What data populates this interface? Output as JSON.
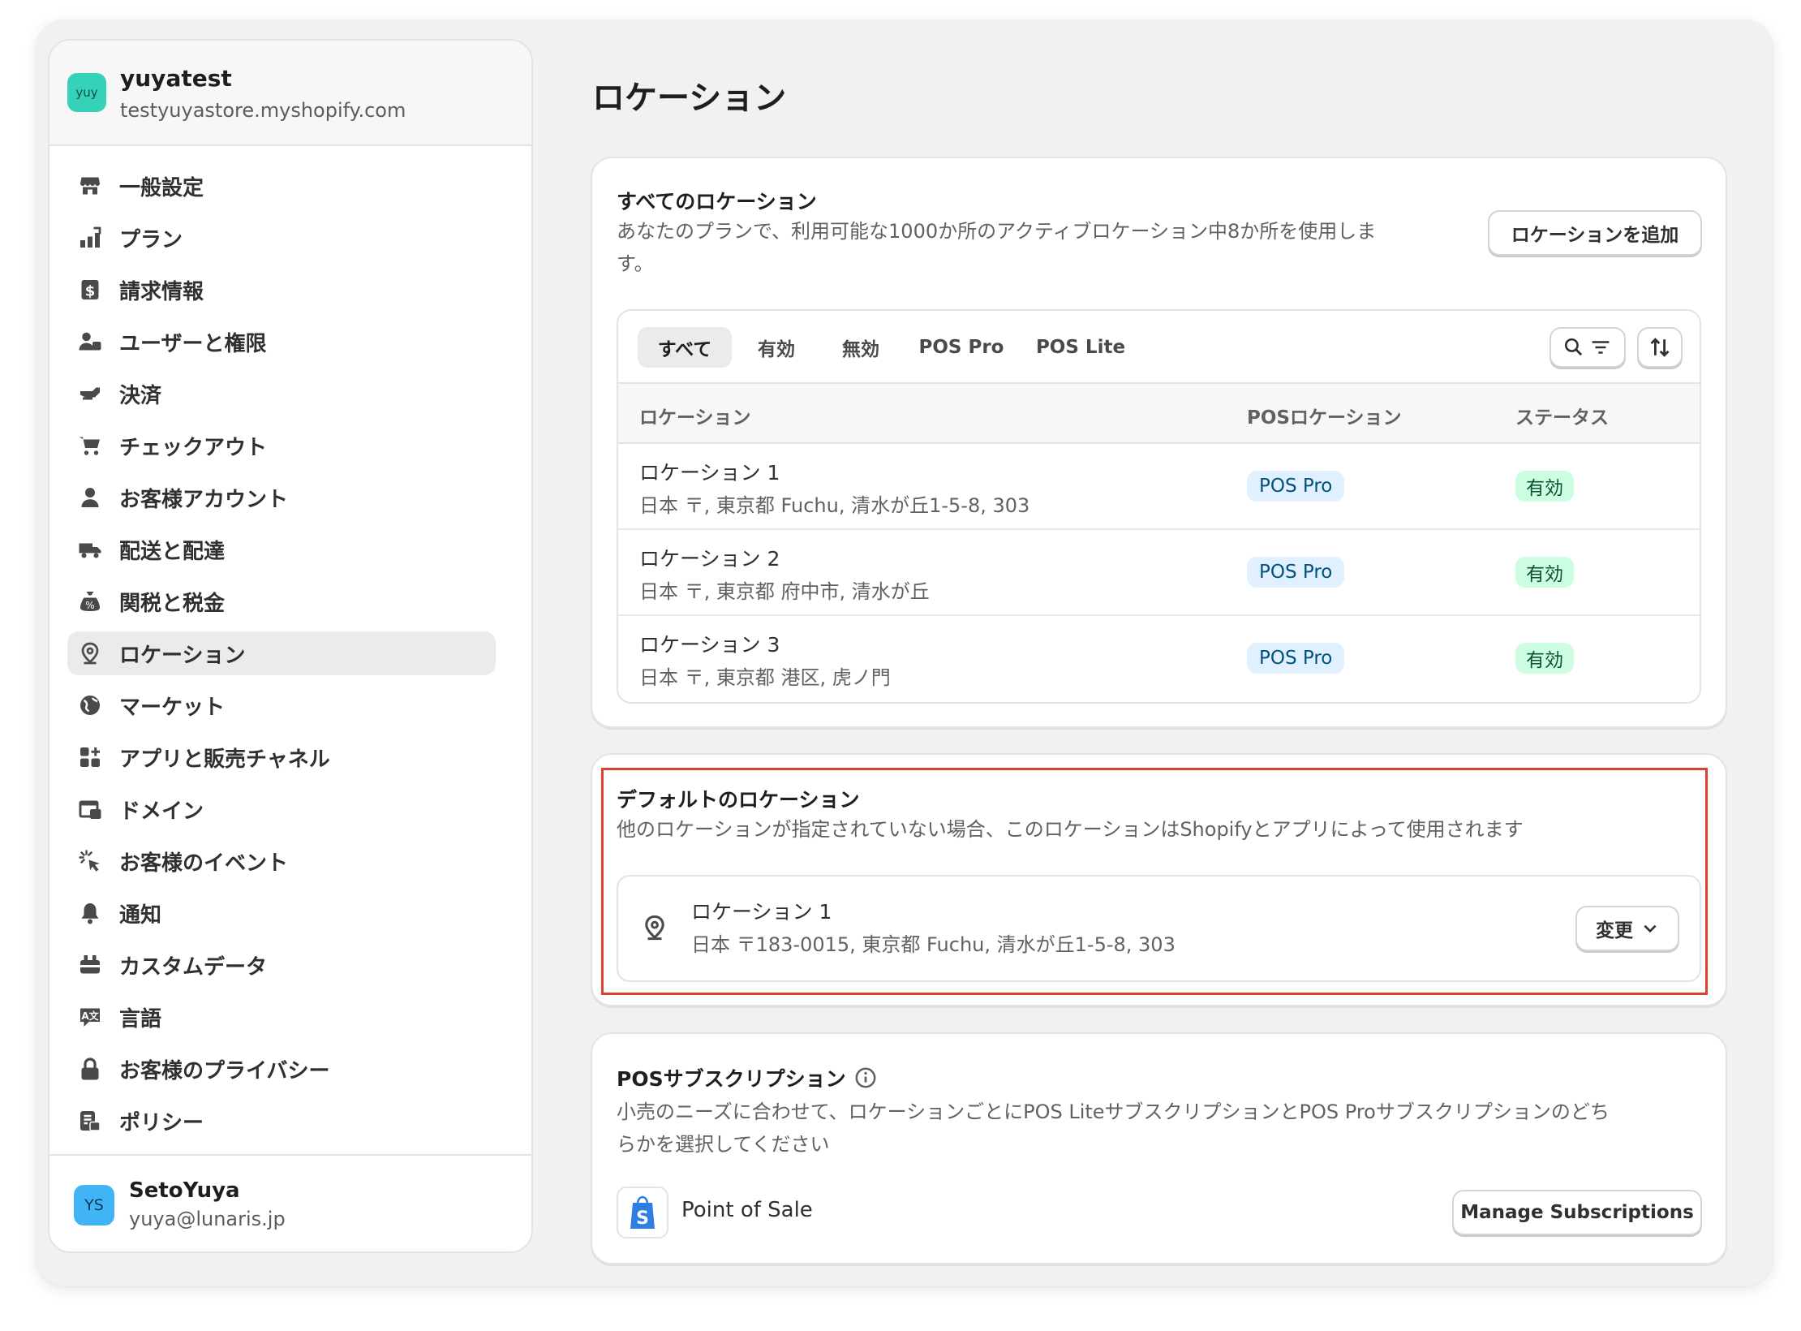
{
  "store": {
    "avatar": "yuy",
    "name": "yuyatest",
    "domain": "testyuyastore.myshopify.com"
  },
  "sidebar": {
    "items": [
      {
        "label": "一般設定",
        "icon": "store-icon"
      },
      {
        "label": "プラン",
        "icon": "plan-chart-icon"
      },
      {
        "label": "請求情報",
        "icon": "billing-icon"
      },
      {
        "label": "ユーザーと権限",
        "icon": "users-icon"
      },
      {
        "label": "決済",
        "icon": "payment-hand-icon"
      },
      {
        "label": "チェックアウト",
        "icon": "cart-icon"
      },
      {
        "label": "お客様アカウント",
        "icon": "person-icon"
      },
      {
        "label": "配送と配達",
        "icon": "truck-icon"
      },
      {
        "label": "関税と税金",
        "icon": "tax-bag-icon"
      },
      {
        "label": "ロケーション",
        "icon": "location-pin-icon",
        "active": true
      },
      {
        "label": "マーケット",
        "icon": "globe-icon"
      },
      {
        "label": "アプリと販売チャネル",
        "icon": "apps-icon"
      },
      {
        "label": "ドメイン",
        "icon": "domain-icon"
      },
      {
        "label": "お客様のイベント",
        "icon": "cursor-click-icon"
      },
      {
        "label": "通知",
        "icon": "bell-icon"
      },
      {
        "label": "カスタムデータ",
        "icon": "custom-data-icon"
      },
      {
        "label": "言語",
        "icon": "language-icon"
      },
      {
        "label": "お客様のプライバシー",
        "icon": "lock-icon"
      },
      {
        "label": "ポリシー",
        "icon": "policy-icon"
      }
    ]
  },
  "user": {
    "initials": "YS",
    "name": "SetoYuya",
    "email": "yuya@lunaris.jp"
  },
  "page": {
    "title": "ロケーション"
  },
  "all_locations": {
    "title": "すべてのロケーション",
    "description_line1": "あなたのプランで、利用可能な1000か所のアクティブロケーション中8か所を使用しま",
    "description_line2": "す。",
    "add_button": "ロケーションを追加",
    "tabs": [
      "すべて",
      "有効",
      "無効",
      "POS Pro",
      "POS Lite"
    ],
    "columns": [
      "ロケーション",
      "POSロケーション",
      "ステータス"
    ],
    "rows": [
      {
        "name": "ロケーション 1",
        "address": "日本 〒, 東京都 Fuchu, 清水が丘1-5-8, 303",
        "pos": "POS Pro",
        "status": "有効"
      },
      {
        "name": "ロケーション 2",
        "address": "日本 〒, 東京都 府中市, 清水が丘",
        "pos": "POS Pro",
        "status": "有効"
      },
      {
        "name": "ロケーション 3",
        "address": "日本 〒, 東京都 港区, 虎ノ門",
        "pos": "POS Pro",
        "status": "有効"
      }
    ]
  },
  "default_location": {
    "title": "デフォルトのロケーション",
    "description": "他のロケーションが指定されていない場合、このロケーションはShopifyとアプリによって使用されます",
    "name": "ロケーション 1",
    "address": "日本 〒183-0015, 東京都 Fuchu, 清水が丘1-5-8, 303",
    "change_button": "変更"
  },
  "pos_subscription": {
    "title": "POSサブスクリプション",
    "description_line1": "小売のニーズに合わせて、ロケーションごとにPOS LiteサブスクリプションとPOS Proサブスクリプションのどち",
    "description_line2": "らかを選択してください",
    "app_name": "Point of Sale",
    "manage_button": "Manage Subscriptions"
  },
  "colors": {
    "highlight": "#e0402f",
    "pos_badge_bg": "#e0f0ff",
    "status_badge_bg": "#cdfee1",
    "shopify_green": "#95bf47"
  }
}
